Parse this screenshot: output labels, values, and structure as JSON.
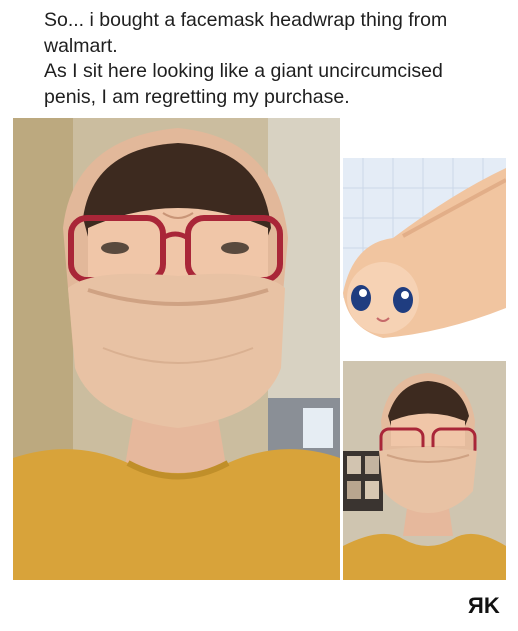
{
  "post": {
    "line1": "So... i bought a facemask headwrap thing from",
    "line2": "walmart.",
    "line3": "As I sit here looking like a giant uncircumcised",
    "line4": "penis, I am regretting my purchase."
  },
  "images": {
    "main": {
      "depicts": "main-photo"
    },
    "cartoon": {
      "depicts": "cartoon-photo"
    },
    "small": {
      "depicts": "small-photo"
    }
  },
  "watermark": {
    "text": "ЯK"
  },
  "colors": {
    "mask": "#e8c2a4",
    "sweater": "#d9a43a",
    "glasses": "#b02a3a",
    "wall": "#c9b99c",
    "cartoon_bg": "#e8eef6"
  }
}
